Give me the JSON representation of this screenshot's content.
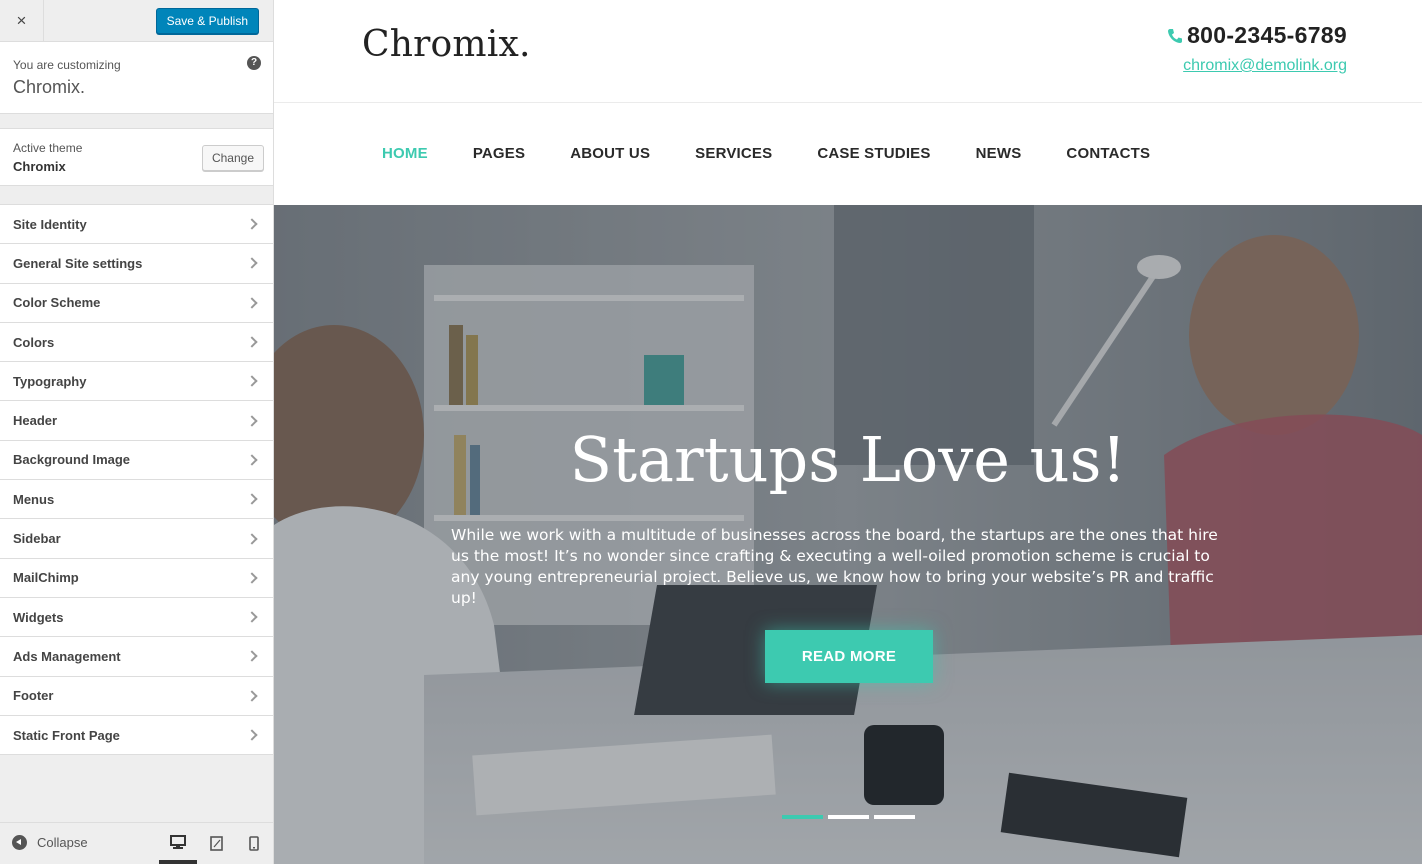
{
  "customizer": {
    "close_label": "×",
    "save_label": "Save & Publish",
    "customizing_label": "You are customizing",
    "site_name": "Chromix.",
    "help_label": "?",
    "active_theme_label": "Active theme",
    "active_theme_name": "Chromix",
    "change_label": "Change",
    "panels": [
      {
        "label": "Site Identity"
      },
      {
        "label": "General Site settings"
      },
      {
        "label": "Color Scheme"
      },
      {
        "label": "Colors"
      },
      {
        "label": "Typography"
      },
      {
        "label": "Header"
      },
      {
        "label": "Background Image"
      },
      {
        "label": "Menus"
      },
      {
        "label": "Sidebar"
      },
      {
        "label": "MailChimp"
      },
      {
        "label": "Widgets"
      },
      {
        "label": "Ads Management"
      },
      {
        "label": "Footer"
      },
      {
        "label": "Static Front Page"
      }
    ],
    "collapse_label": "Collapse",
    "device_active": "desktop"
  },
  "site": {
    "logo": "Chromix.",
    "phone": "800-2345-6789",
    "email": "chromix@demolink.org",
    "accent_color": "#3dcab0",
    "nav": [
      {
        "label": "HOME",
        "active": true
      },
      {
        "label": "PAGES"
      },
      {
        "label": "ABOUT US"
      },
      {
        "label": "SERVICES"
      },
      {
        "label": "CASE STUDIES"
      },
      {
        "label": "NEWS"
      },
      {
        "label": "CONTACTS"
      }
    ],
    "hero": {
      "title": "Startups Love us!",
      "text": "While we work with a multitude of businesses across the board, the startups are the ones that hire us the most! It’s no wonder since crafting & executing a well-oiled promotion scheme is crucial to any young entrepreneurial project. Believe us, we know how to bring your website’s PR and traffic up!",
      "button_label": "READ MORE",
      "slides": 3,
      "active_slide": 1
    }
  }
}
